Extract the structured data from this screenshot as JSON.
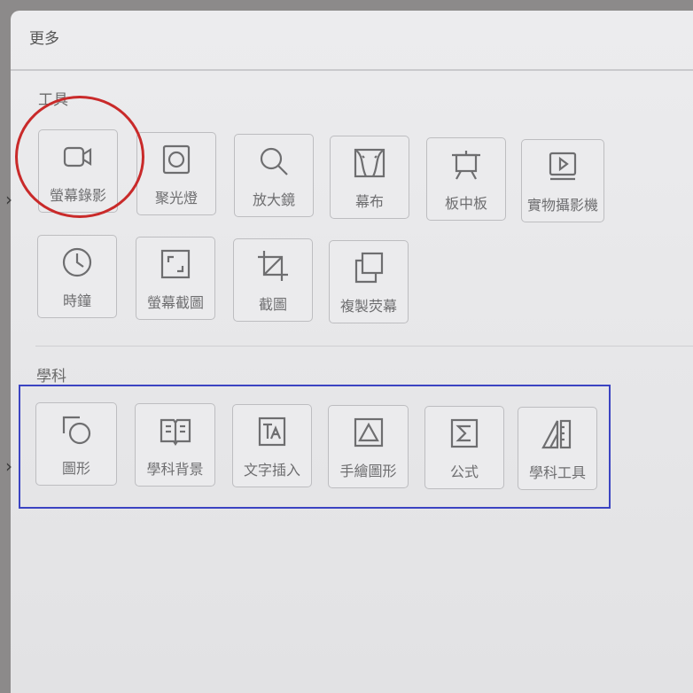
{
  "panel": {
    "title": "更多"
  },
  "tools": {
    "section_label": "工具",
    "items": [
      {
        "label": "螢幕錄影",
        "icon": "video-camera-icon"
      },
      {
        "label": "聚光燈",
        "icon": "spotlight-icon"
      },
      {
        "label": "放大鏡",
        "icon": "magnifier-icon"
      },
      {
        "label": "幕布",
        "icon": "curtain-icon"
      },
      {
        "label": "板中板",
        "icon": "easel-board-icon"
      },
      {
        "label": "實物攝影機",
        "icon": "document-camera-icon"
      },
      {
        "label": "時鐘",
        "icon": "clock-icon"
      },
      {
        "label": "螢幕截圖",
        "icon": "screenshot-frame-icon"
      },
      {
        "label": "截圖",
        "icon": "crop-icon"
      },
      {
        "label": "複製荧幕",
        "icon": "copy-screen-icon"
      }
    ]
  },
  "subjects": {
    "section_label": "學科",
    "items": [
      {
        "label": "圖形",
        "icon": "shapes-icon"
      },
      {
        "label": "學科背景",
        "icon": "open-book-icon"
      },
      {
        "label": "文字插入",
        "icon": "text-box-icon"
      },
      {
        "label": "手繪圖形",
        "icon": "triangle-drawing-icon"
      },
      {
        "label": "公式",
        "icon": "sigma-formula-icon"
      },
      {
        "label": "學科工具",
        "icon": "ruler-triangle-icon"
      }
    ]
  },
  "annotations": {
    "red_circle_color": "#c92a2a",
    "blue_box_color": "#3b44c2"
  }
}
